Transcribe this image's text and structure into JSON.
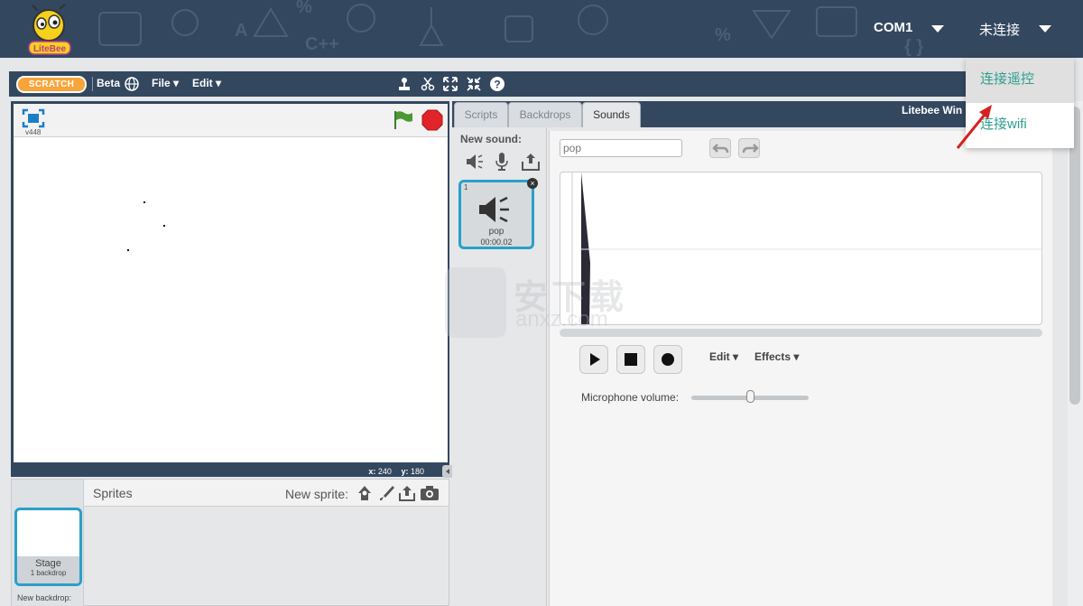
{
  "topbar": {
    "logo_text": "LiteBee",
    "port_label": "COM1",
    "connection_status": "未连接"
  },
  "dropdown": {
    "items": [
      {
        "label": "连接遥控"
      },
      {
        "label": "连接wifi"
      }
    ]
  },
  "menubar": {
    "scratch_logo": "SCRATCH",
    "beta_label": "Beta",
    "file_menu": "File ▾",
    "edit_menu": "Edit ▾"
  },
  "stage": {
    "version": "v448",
    "x_label": "x:",
    "x_value": "240",
    "y_label": "y:",
    "y_value": "180"
  },
  "sprites": {
    "title": "Sprites",
    "new_sprite_label": "New sprite:",
    "stage_name": "Stage",
    "stage_backdrops": "1 backdrop",
    "new_backdrop_label": "New backdrop:"
  },
  "tabs": [
    {
      "label": "Scripts",
      "active": false
    },
    {
      "label": "Backdrops",
      "active": false
    },
    {
      "label": "Sounds",
      "active": true
    }
  ],
  "project_title": "Litebee Win",
  "sounds": {
    "new_sound_label": "New sound:",
    "items": [
      {
        "index": "1",
        "name": "pop",
        "duration": "00:00.02"
      }
    ]
  },
  "editor": {
    "sound_name_value": "pop",
    "edit_menu": "Edit ▾",
    "effects_menu": "Effects ▾",
    "mic_label": "Microphone volume:",
    "mic_volume": 0.5
  },
  "watermark": {
    "text": "安下载",
    "url": "anxz.com"
  },
  "colors": {
    "header_bg": "#33475f",
    "accent": "#2aa0c8",
    "dropdown_text": "#2d9e8e",
    "stop": "#e0242a",
    "flag": "#3a7d2c"
  }
}
